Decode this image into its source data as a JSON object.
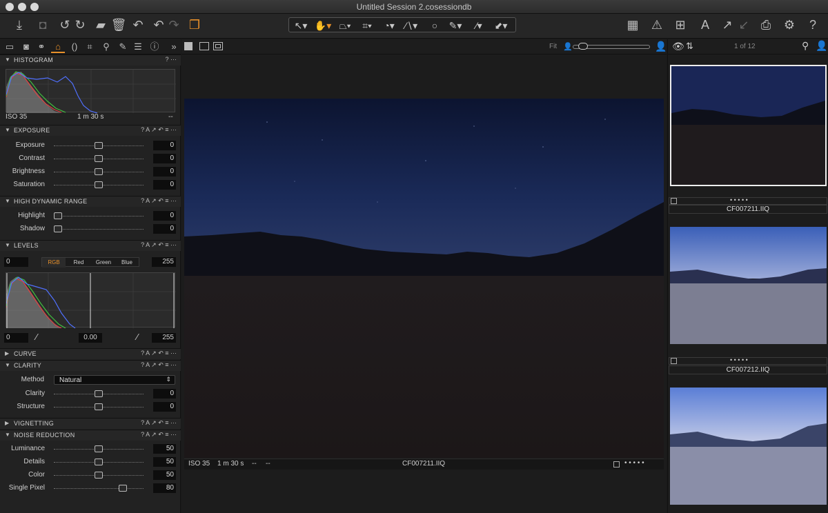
{
  "window": {
    "title": "Untitled Session 2.cosessiondb"
  },
  "histogram": {
    "title": "HISTOGRAM",
    "iso": "ISO 35",
    "exposure_time": "1 m 30 s",
    "extra": "--"
  },
  "exposure": {
    "title": "EXPOSURE",
    "items": [
      {
        "label": "Exposure",
        "value": "0",
        "pos": 0.5
      },
      {
        "label": "Contrast",
        "value": "0",
        "pos": 0.5
      },
      {
        "label": "Brightness",
        "value": "0",
        "pos": 0.5
      },
      {
        "label": "Saturation",
        "value": "0",
        "pos": 0.5
      }
    ]
  },
  "hdr": {
    "title": "HIGH DYNAMIC RANGE",
    "items": [
      {
        "label": "Highlight",
        "value": "0",
        "pos": 0.0
      },
      {
        "label": "Shadow",
        "value": "0",
        "pos": 0.0
      }
    ]
  },
  "levels": {
    "title": "LEVELS",
    "input_low": "0",
    "input_high": "255",
    "channels": [
      "RGB",
      "Red",
      "Green",
      "Blue"
    ],
    "output_low": "0",
    "mid": "0.00",
    "output_high": "255"
  },
  "curve": {
    "title": "CURVE"
  },
  "clarity": {
    "title": "CLARITY",
    "method_label": "Method",
    "method_value": "Natural",
    "items": [
      {
        "label": "Clarity",
        "value": "0",
        "pos": 0.5
      },
      {
        "label": "Structure",
        "value": "0",
        "pos": 0.5
      }
    ]
  },
  "vignetting": {
    "title": "VIGNETTING"
  },
  "noise": {
    "title": "NOISE REDUCTION",
    "items": [
      {
        "label": "Luminance",
        "value": "50",
        "pos": 0.5
      },
      {
        "label": "Details",
        "value": "50",
        "pos": 0.5
      },
      {
        "label": "Color",
        "value": "50",
        "pos": 0.5
      },
      {
        "label": "Single Pixel",
        "value": "80",
        "pos": 0.8
      }
    ]
  },
  "viewer": {
    "fit_label": "Fit",
    "iso": "ISO 35",
    "exposure_time": "1 m 30 s",
    "dash1": "--",
    "dash2": "--",
    "filename": "CF007211.IIQ",
    "rating": "• • • • •"
  },
  "browser": {
    "counter": "1 of 12",
    "thumbs": [
      {
        "name": "CF007211.IIQ",
        "rating": "• • • • •"
      },
      {
        "name": "CF007212.IIQ",
        "rating": "• • • • •"
      }
    ]
  },
  "header_actions": "? A ↗ ↶ ≡ ···",
  "header_actions_short": "? ···"
}
